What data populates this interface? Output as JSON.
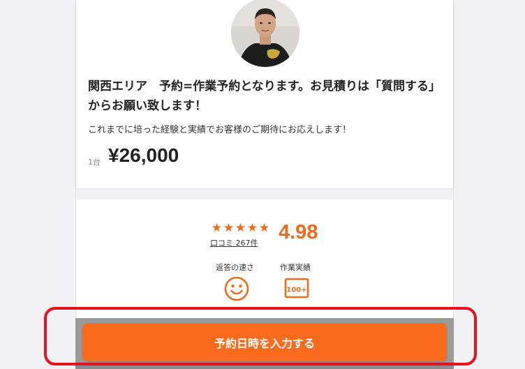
{
  "listing": {
    "title": "関西エリア　予約=作業予約となります。お見積りは「質問する」からお願い致します！",
    "subtitle": "これまでに培った経験と実績でお客様のご期待にお応えします！",
    "unit": "1台",
    "price": "¥26,000"
  },
  "rating": {
    "stars": [
      "★",
      "★",
      "★",
      "★",
      "★"
    ],
    "reviews_label": "口コミ 267件",
    "score": "4.98"
  },
  "metrics": [
    {
      "label": "返答の速さ",
      "icon": "smiley-face-icon"
    },
    {
      "label": "作業実績",
      "icon": "hundred-plus-icon"
    }
  ],
  "cta": {
    "label": "予約日時を入力する"
  },
  "colors": {
    "accent": "#fb6b1e",
    "star": "#f06a1c",
    "highlight": "#e4131f"
  }
}
